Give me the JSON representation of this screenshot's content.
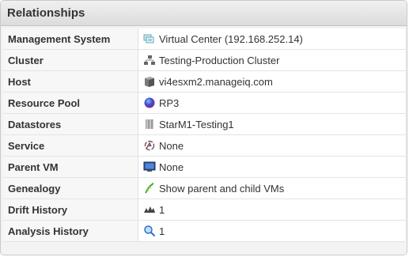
{
  "panel": {
    "title": "Relationships"
  },
  "rows": [
    {
      "label": "Management System",
      "value": "Virtual Center (192.168.252.14)",
      "icon": "virtual-center-icon"
    },
    {
      "label": "Cluster",
      "value": "Testing-Production Cluster",
      "icon": "cluster-icon"
    },
    {
      "label": "Host",
      "value": "vi4esxm2.manageiq.com",
      "icon": "host-icon"
    },
    {
      "label": "Resource Pool",
      "value": "RP3",
      "icon": "resource-pool-icon"
    },
    {
      "label": "Datastores",
      "value": "StarM1-Testing1",
      "icon": "datastore-icon"
    },
    {
      "label": "Service",
      "value": "None",
      "icon": "service-icon"
    },
    {
      "label": "Parent VM",
      "value": "None",
      "icon": "parent-vm-icon"
    },
    {
      "label": "Genealogy",
      "value": "Show parent and child VMs",
      "icon": "genealogy-icon"
    },
    {
      "label": "Drift History",
      "value": "1",
      "icon": "drift-history-icon"
    },
    {
      "label": "Analysis History",
      "value": "1",
      "icon": "analysis-search-icon"
    }
  ]
}
